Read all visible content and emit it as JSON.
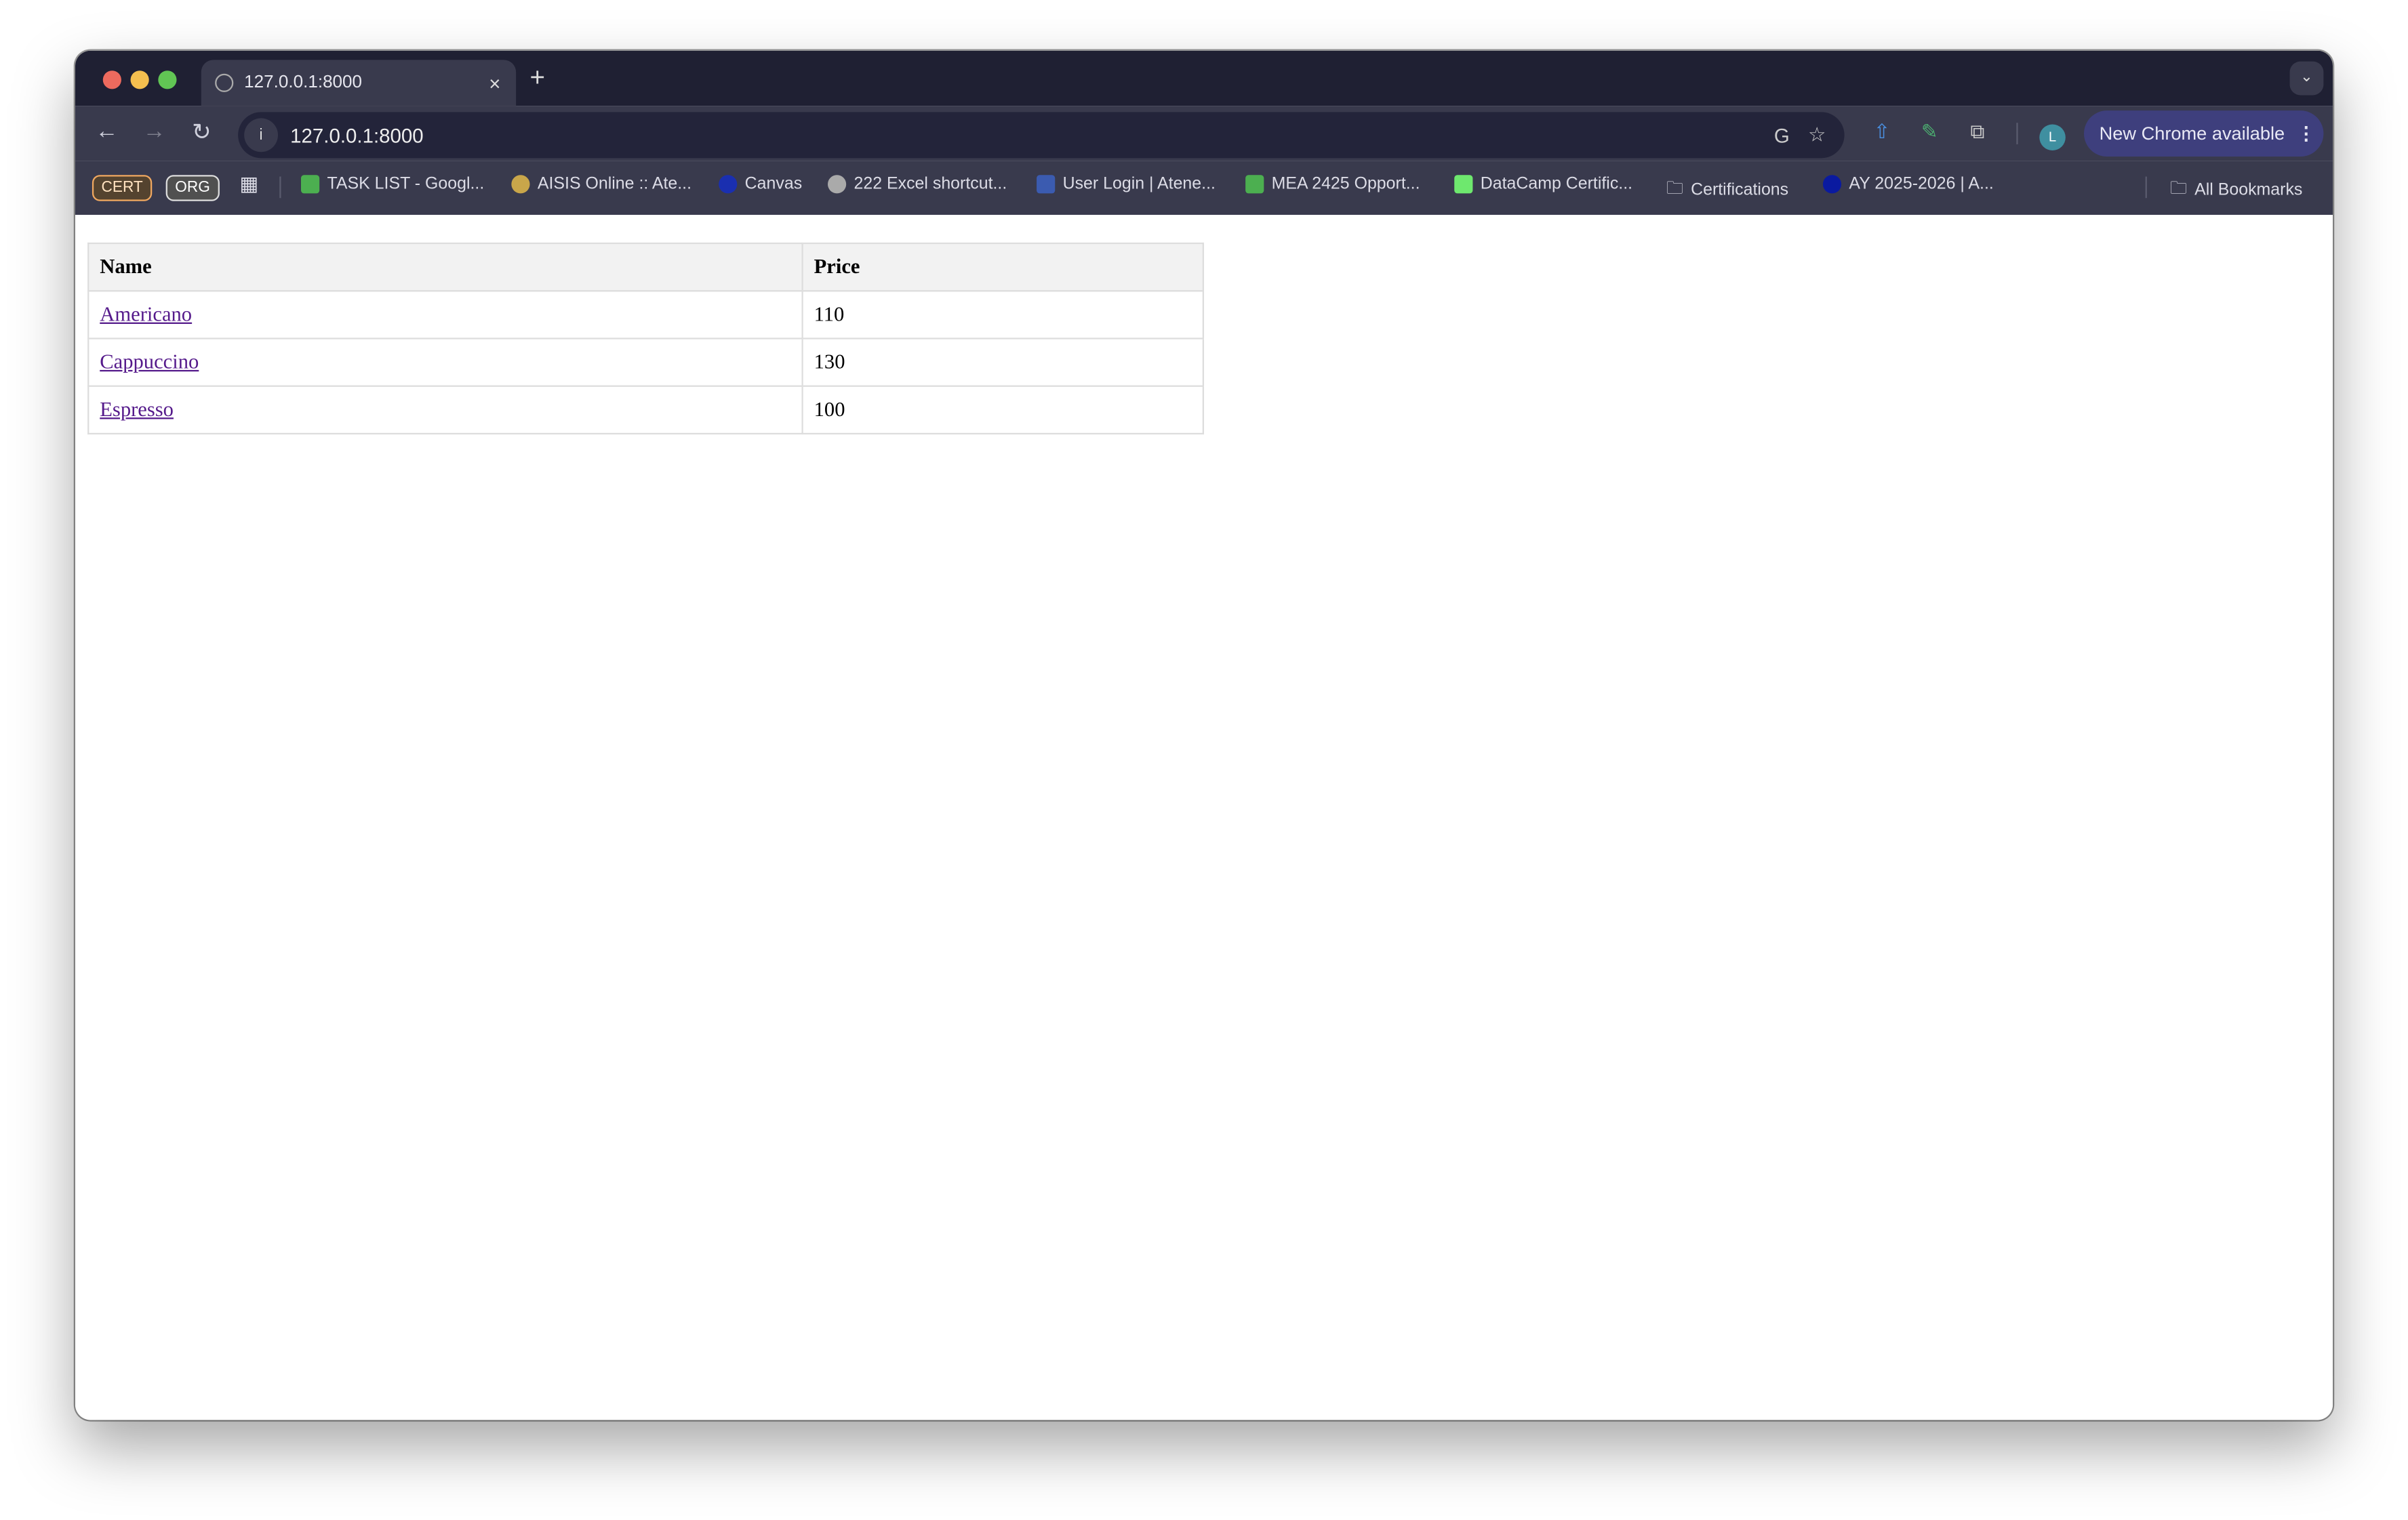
{
  "window": {
    "traffic_lights": {
      "close": "#ed6a5e",
      "minimize": "#f5bf4f",
      "zoom": "#61c554"
    }
  },
  "tab": {
    "title": "127.0.0.1:8000",
    "close": "×",
    "new_tab": "+",
    "tab_menu": "⌄"
  },
  "toolbar": {
    "back": "←",
    "forward": "→",
    "reload": "↻",
    "url": "127.0.0.1:8000",
    "update_label": "New Chrome available",
    "menu": "⋮",
    "avatar_initial": "L"
  },
  "bookmarks": {
    "chips": [
      "CERT",
      "ORG"
    ],
    "items": [
      "TASK LIST - Googl...",
      "AISIS Online :: Ate...",
      "Canvas",
      "222 Excel shortcut...",
      "User Login | Atene...",
      "MEA 2425 Opport...",
      "DataCamp Certific...",
      "Certifications",
      "AY 2025-2026 | A..."
    ],
    "all": "All Bookmarks"
  },
  "table": {
    "headers": [
      "Name",
      "Price"
    ],
    "rows": [
      {
        "name": "Americano",
        "price": "110"
      },
      {
        "name": "Cappuccino",
        "price": "130"
      },
      {
        "name": "Espresso",
        "price": "100"
      }
    ]
  }
}
